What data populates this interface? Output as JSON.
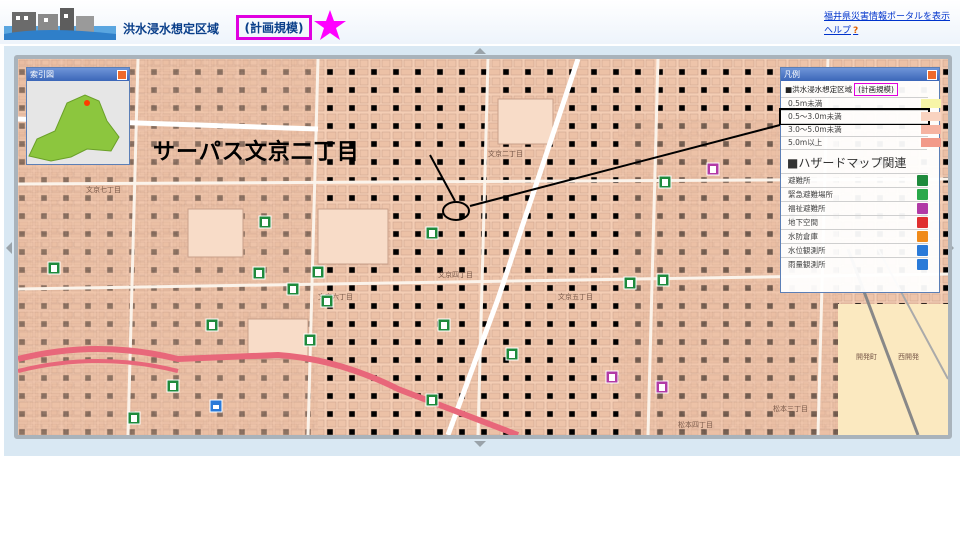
{
  "header": {
    "title": "洪水浸水想定区域",
    "scale_badge": "(計画規模)",
    "portal_link": "福井県災害情報ポータルを表示",
    "help_link": "ヘルプ",
    "help_icon": "?"
  },
  "index_map": {
    "title": "索引図"
  },
  "annotation": {
    "place_name": "サーパス文京二丁目"
  },
  "legend": {
    "title": "凡例",
    "layer_label": "■洪水浸水想定区域",
    "layer_scale": "(計画規模)",
    "depth_rows": [
      {
        "label": "0.5m未満",
        "color": "#f7f5a8"
      },
      {
        "label": "0.5〜3.0m未満",
        "color": "#f9d3c0"
      },
      {
        "label": "3.0〜5.0m未満",
        "color": "#f6b3a1"
      },
      {
        "label": "5.0m以上",
        "color": "#f29a8a"
      }
    ],
    "hazard_title": "■ハザードマップ関連",
    "hazard_rows": [
      {
        "label": "避難所",
        "icon": "shelter-icon",
        "color": "#1e8a3c"
      },
      {
        "label": "緊急避難場所",
        "icon": "emergency-site-icon",
        "color": "#2aa84a"
      },
      {
        "label": "福祉避難所",
        "icon": "welfare-shelter-icon",
        "color": "#b13aa6"
      },
      {
        "label": "地下空間",
        "icon": "underground-icon",
        "color": "#e03030"
      },
      {
        "label": "水防倉庫",
        "icon": "flood-warehouse-icon",
        "color": "#f08a1a"
      },
      {
        "label": "水位観測所",
        "icon": "water-level-icon",
        "color": "#2a7ad8"
      },
      {
        "label": "雨量観測所",
        "icon": "rain-gauge-icon",
        "color": "#2a7ad8"
      }
    ]
  },
  "map": {
    "district_labels": [
      "文京二丁目",
      "文京四丁目",
      "文京五丁目",
      "文京六丁目",
      "文京七丁目",
      "開発町",
      "西開発",
      "松本三丁目",
      "松本四丁目"
    ]
  }
}
